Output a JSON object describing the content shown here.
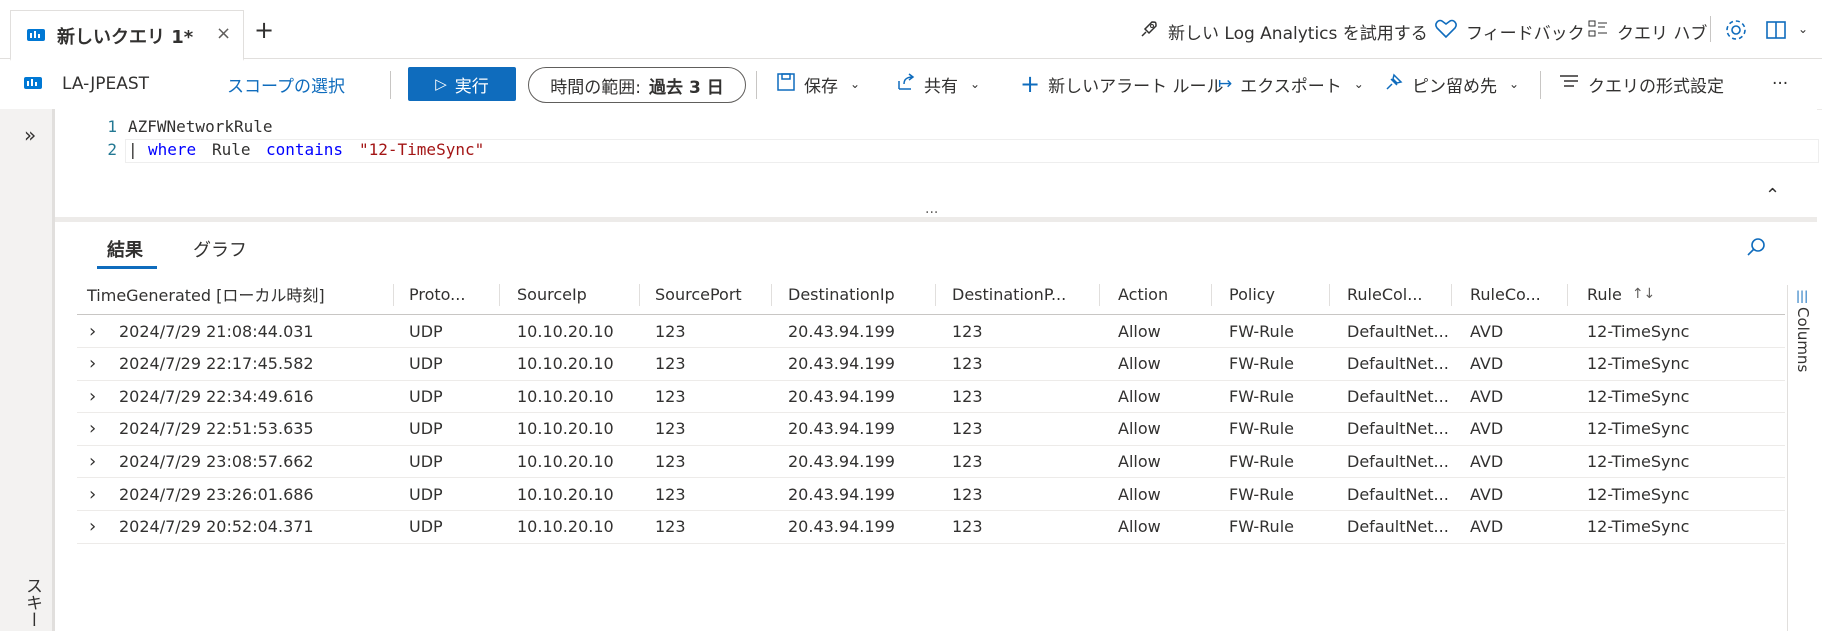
{
  "tab": {
    "title": "新しいクエリ 1*",
    "close": "×",
    "add": "+"
  },
  "top_actions": {
    "try_new": "新しい Log Analytics を試用する",
    "feedback": "フィードバック",
    "query_hub": "クエリ ハブ"
  },
  "toolbar": {
    "workspace": "LA-JPEAST",
    "scope": "スコープの選択",
    "run": "実行",
    "time_range_label": "時間の範囲:",
    "time_range_value": "過去 3 日",
    "save": "保存",
    "share": "共有",
    "new_alert": "新しいアラート ルール",
    "export": "エクスポート",
    "pin": "ピン留め先",
    "format": "クエリの形式設定",
    "more": "···"
  },
  "editor": {
    "lines": [
      {
        "num": "1",
        "text": "AZFWNetworkRule"
      },
      {
        "num": "2",
        "pipe": "|",
        "kw1": "where",
        "field": "Rule",
        "kw2": "contains",
        "str": "\"12-TimeSync\""
      }
    ],
    "splitter_dots": "···"
  },
  "rail": {
    "expand": "»",
    "vertical_text": "スキー"
  },
  "results": {
    "tabs": [
      "結果",
      "グラフ"
    ],
    "columns_label": "Columns",
    "headers": [
      "TimeGenerated [ローカル時刻]",
      "Proto...",
      "SourceIp",
      "SourcePort",
      "DestinationIp",
      "DestinationP...",
      "Action",
      "Policy",
      "RuleCol...",
      "RuleCo...",
      "Rule"
    ],
    "rows": [
      [
        "2024/7/29 21:08:44.031",
        "UDP",
        "10.10.20.10",
        "123",
        "20.43.94.199",
        "123",
        "Allow",
        "FW-Rule",
        "DefaultNet...",
        "AVD",
        "12-TimeSync"
      ],
      [
        "2024/7/29 22:17:45.582",
        "UDP",
        "10.10.20.10",
        "123",
        "20.43.94.199",
        "123",
        "Allow",
        "FW-Rule",
        "DefaultNet...",
        "AVD",
        "12-TimeSync"
      ],
      [
        "2024/7/29 22:34:49.616",
        "UDP",
        "10.10.20.10",
        "123",
        "20.43.94.199",
        "123",
        "Allow",
        "FW-Rule",
        "DefaultNet...",
        "AVD",
        "12-TimeSync"
      ],
      [
        "2024/7/29 22:51:53.635",
        "UDP",
        "10.10.20.10",
        "123",
        "20.43.94.199",
        "123",
        "Allow",
        "FW-Rule",
        "DefaultNet...",
        "AVD",
        "12-TimeSync"
      ],
      [
        "2024/7/29 23:08:57.662",
        "UDP",
        "10.10.20.10",
        "123",
        "20.43.94.199",
        "123",
        "Allow",
        "FW-Rule",
        "DefaultNet...",
        "AVD",
        "12-TimeSync"
      ],
      [
        "2024/7/29 23:26:01.686",
        "UDP",
        "10.10.20.10",
        "123",
        "20.43.94.199",
        "123",
        "Allow",
        "FW-Rule",
        "DefaultNet...",
        "AVD",
        "12-TimeSync"
      ],
      [
        "2024/7/29 20:52:04.371",
        "UDP",
        "10.10.20.10",
        "123",
        "20.43.94.199",
        "123",
        "Allow",
        "FW-Rule",
        "DefaultNet...",
        "AVD",
        "12-TimeSync"
      ]
    ]
  },
  "colors": {
    "accent": "#0f6cbd",
    "keyword": "#0000ff",
    "string": "#a31515",
    "line_number": "#237893"
  }
}
